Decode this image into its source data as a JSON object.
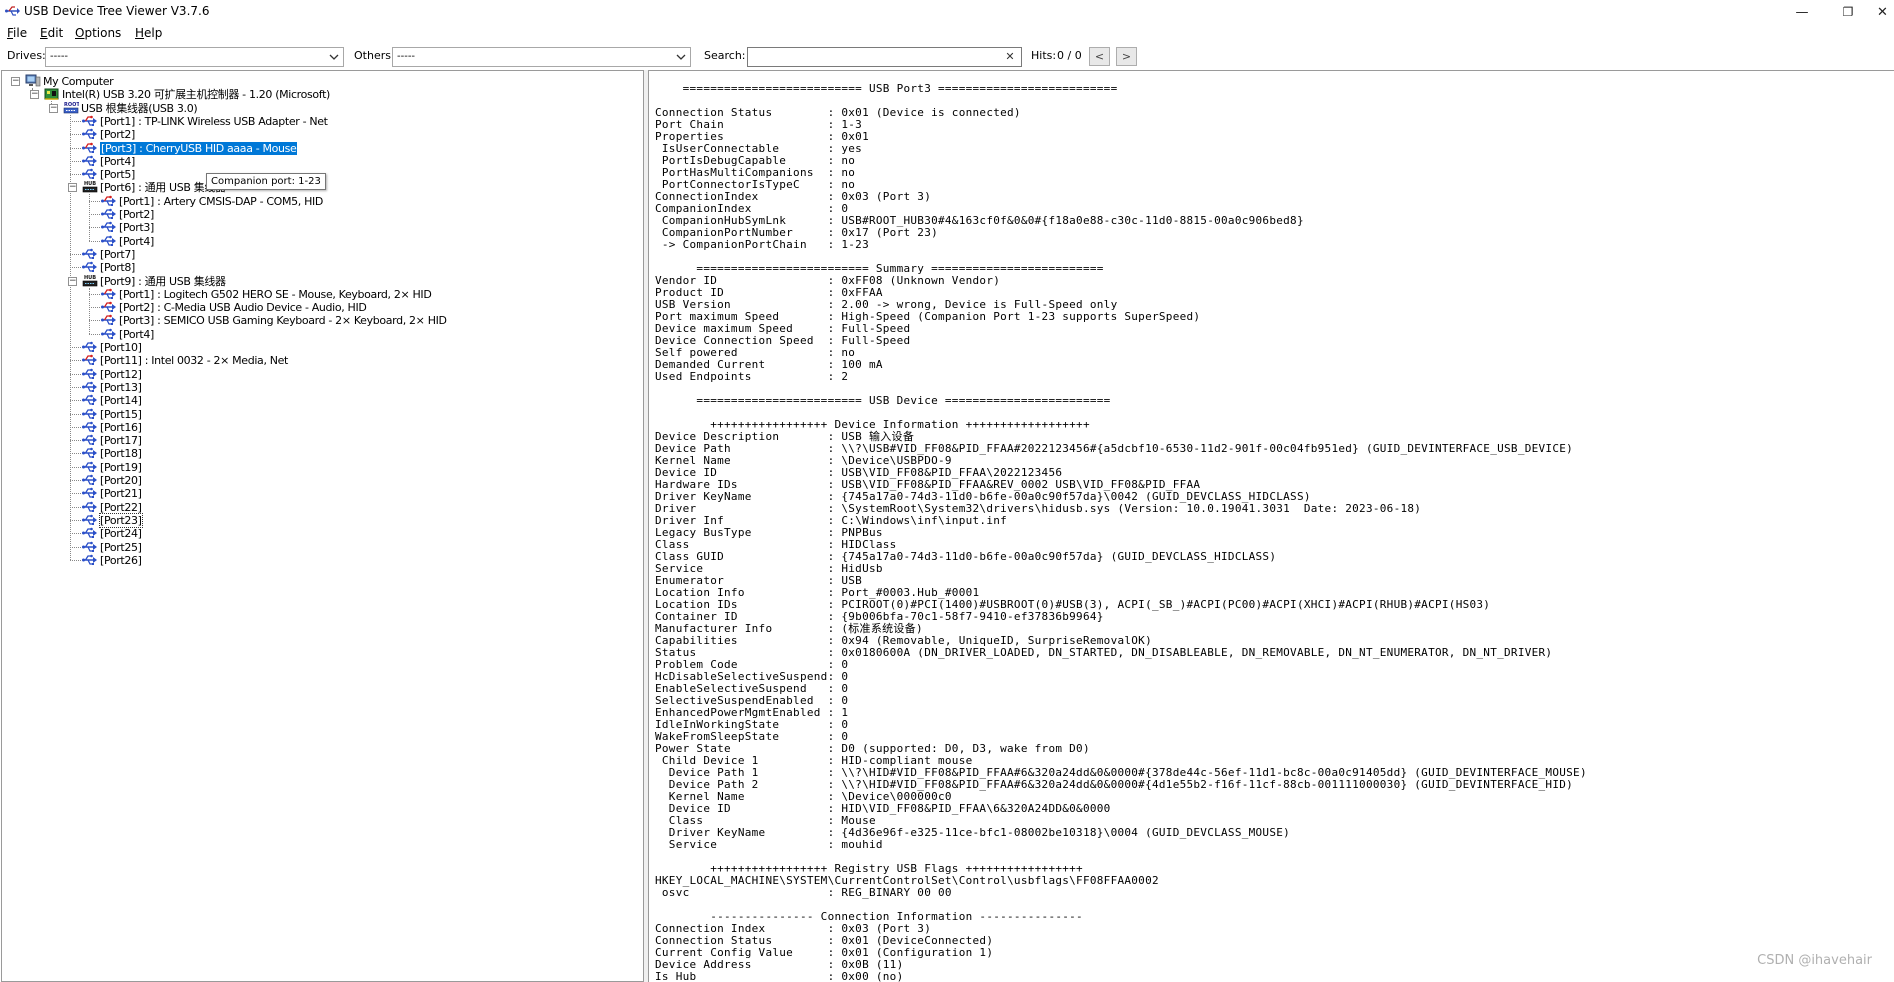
{
  "window": {
    "title": "USB Device Tree Viewer V3.7.6",
    "minimize": "—",
    "maximize": "❐",
    "close": "✕"
  },
  "menu": [
    {
      "label": "File",
      "mnemonic": "F",
      "rest": "ile"
    },
    {
      "label": "Edit",
      "mnemonic": "E",
      "rest": "dit"
    },
    {
      "label": "Options",
      "mnemonic": "O",
      "rest": "ptions"
    },
    {
      "label": "Help",
      "mnemonic": "H",
      "rest": "elp"
    }
  ],
  "toolbar": {
    "drives_label": "Drives:",
    "drives_value": "-----",
    "others_label": "Others:",
    "others_value": "-----",
    "search_label": "Search:",
    "search_value": "",
    "hits_label": "Hits:",
    "hits_value": "0 / 0",
    "prev": "<",
    "next": ">"
  },
  "tree": {
    "nodes": [
      {
        "label": "My Computer",
        "level": 0,
        "icon": "computer-icon",
        "expander": "−"
      },
      {
        "label": "Intel(R) USB 3.20 可扩展主机控制器 - 1.20 (Microsoft)",
        "level": 1,
        "icon": "host-controller-icon",
        "expander": "−"
      },
      {
        "label": "USB 根集线器(USB 3.0)",
        "level": 2,
        "icon": "root-hub-icon",
        "expander": "−"
      },
      {
        "label": "[Port1] : TP-LINK Wireless USB Adapter - Net",
        "level": 3,
        "icon": "usb-device-icon"
      },
      {
        "label": "[Port2]",
        "level": 3,
        "icon": "usb-port-icon"
      },
      {
        "label": "[Port3] : CherryUSB HID aaaa - Mouse",
        "level": 3,
        "icon": "usb-device-icon",
        "selected": true
      },
      {
        "label": "[Port4]",
        "level": 3,
        "icon": "usb-port-icon"
      },
      {
        "label": "[Port5]",
        "level": 3,
        "icon": "usb-port-icon"
      },
      {
        "label": "[Port6] : 通用 USB 集线器",
        "level": 3,
        "icon": "hub-icon",
        "expander": "−"
      },
      {
        "label": "[Port1] : Artery CMSIS-DAP - COM5, HID",
        "level": 4,
        "icon": "usb-device-icon"
      },
      {
        "label": "[Port2]",
        "level": 4,
        "icon": "usb-port-icon"
      },
      {
        "label": "[Port3]",
        "level": 4,
        "icon": "usb-port-icon"
      },
      {
        "label": "[Port4]",
        "level": 4,
        "icon": "usb-port-icon"
      },
      {
        "label": "[Port7]",
        "level": 3,
        "icon": "usb-port-icon"
      },
      {
        "label": "[Port8]",
        "level": 3,
        "icon": "usb-port-icon"
      },
      {
        "label": "[Port9] : 通用 USB 集线器",
        "level": 3,
        "icon": "hub-icon",
        "expander": "−"
      },
      {
        "label": "[Port1] : Logitech G502 HERO SE - Mouse, Keyboard, 2× HID",
        "level": 4,
        "icon": "usb-device-icon"
      },
      {
        "label": "[Port2] : C-Media USB Audio Device - Audio, HID",
        "level": 4,
        "icon": "usb-device-icon"
      },
      {
        "label": "[Port3] : SEMICO USB Gaming Keyboard - 2× Keyboard, 2× HID",
        "level": 4,
        "icon": "usb-device-icon"
      },
      {
        "label": "[Port4]",
        "level": 4,
        "icon": "usb-port-icon"
      },
      {
        "label": "[Port10]",
        "level": 3,
        "icon": "usb-port-icon"
      },
      {
        "label": "[Port11] : Intel 0032 - 2× Media, Net",
        "level": 3,
        "icon": "usb-device-icon"
      },
      {
        "label": "[Port12]",
        "level": 3,
        "icon": "usb-port-icon"
      },
      {
        "label": "[Port13]",
        "level": 3,
        "icon": "usb-port-icon"
      },
      {
        "label": "[Port14]",
        "level": 3,
        "icon": "usb-port-icon"
      },
      {
        "label": "[Port15]",
        "level": 3,
        "icon": "usb-port-icon"
      },
      {
        "label": "[Port16]",
        "level": 3,
        "icon": "usb-port-icon"
      },
      {
        "label": "[Port17]",
        "level": 3,
        "icon": "usb-port-icon"
      },
      {
        "label": "[Port18]",
        "level": 3,
        "icon": "usb-port-icon"
      },
      {
        "label": "[Port19]",
        "level": 3,
        "icon": "usb-port-icon"
      },
      {
        "label": "[Port20]",
        "level": 3,
        "icon": "usb-port-icon"
      },
      {
        "label": "[Port21]",
        "level": 3,
        "icon": "usb-port-icon"
      },
      {
        "label": "[Port22]",
        "level": 3,
        "icon": "usb-port-icon"
      },
      {
        "label": "[Port23]",
        "level": 3,
        "icon": "usb-port-icon",
        "boxed": true
      },
      {
        "label": "[Port24]",
        "level": 3,
        "icon": "usb-port-icon"
      },
      {
        "label": "[Port25]",
        "level": 3,
        "icon": "usb-port-icon"
      },
      {
        "label": "[Port26]",
        "level": 3,
        "icon": "usb-port-icon"
      }
    ],
    "tooltip": "Companion port: 1-23"
  },
  "details": {
    "lines": [
      "    ========================== USB Port3 ==========================",
      "",
      "Connection Status        : 0x01 (Device is connected)",
      "Port Chain               : 1-3",
      "Properties               : 0x01",
      " IsUserConnectable       : yes",
      " PortIsDebugCapable      : no",
      " PortHasMultiCompanions  : no",
      " PortConnectorIsTypeC    : no",
      "ConnectionIndex          : 0x03 (Port 3)",
      "CompanionIndex           : 0",
      " CompanionHubSymLnk      : USB#ROOT_HUB30#4&163cf0f&0&0#{f18a0e88-c30c-11d0-8815-00a0c906bed8}",
      " CompanionPortNumber     : 0x17 (Port 23)",
      " -> CompanionPortChain   : 1-23",
      "",
      "      ========================= Summary =========================",
      "Vendor ID                : 0xFF08 (Unknown Vendor)",
      "Product ID               : 0xFFAA",
      "USB Version              : 2.00 -> wrong, Device is Full-Speed only",
      "Port maximum Speed       : High-Speed (Companion Port 1-23 supports SuperSpeed)",
      "Device maximum Speed     : Full-Speed",
      "Device Connection Speed  : Full-Speed",
      "Self powered             : no",
      "Demanded Current         : 100 mA",
      "Used Endpoints           : 2",
      "",
      "      ======================== USB Device ========================",
      "",
      "        +++++++++++++++++ Device Information ++++++++++++++++++",
      "Device Description       : USB 输入设备",
      "Device Path              : \\\\?\\USB#VID_FF08&PID_FFAA#2022123456#{a5dcbf10-6530-11d2-901f-00c04fb951ed} (GUID_DEVINTERFACE_USB_DEVICE)",
      "Kernel Name              : \\Device\\USBPDO-9",
      "Device ID                : USB\\VID_FF08&PID_FFAA\\2022123456",
      "Hardware IDs             : USB\\VID_FF08&PID_FFAA&REV_0002 USB\\VID_FF08&PID_FFAA",
      "Driver KeyName           : {745a17a0-74d3-11d0-b6fe-00a0c90f57da}\\0042 (GUID_DEVCLASS_HIDCLASS)",
      "Driver                   : \\SystemRoot\\System32\\drivers\\hidusb.sys (Version: 10.0.19041.3031  Date: 2023-06-18)",
      "Driver Inf               : C:\\Windows\\inf\\input.inf",
      "Legacy BusType           : PNPBus",
      "Class                    : HIDClass",
      "Class GUID               : {745a17a0-74d3-11d0-b6fe-00a0c90f57da} (GUID_DEVCLASS_HIDCLASS)",
      "Service                  : HidUsb",
      "Enumerator               : USB",
      "Location Info            : Port_#0003.Hub_#0001",
      "Location IDs             : PCIROOT(0)#PCI(1400)#USBROOT(0)#USB(3), ACPI(_SB_)#ACPI(PC00)#ACPI(XHCI)#ACPI(RHUB)#ACPI(HS03)",
      "Container ID             : {9b006bfa-70c1-58f7-9410-ef37836b9964}",
      "Manufacturer Info        : (标准系统设备)",
      "Capabilities             : 0x94 (Removable, UniqueID, SurpriseRemovalOK)",
      "Status                   : 0x0180600A (DN_DRIVER_LOADED, DN_STARTED, DN_DISABLEABLE, DN_REMOVABLE, DN_NT_ENUMERATOR, DN_NT_DRIVER)",
      "Problem Code             : 0",
      "HcDisableSelectiveSuspend: 0",
      "EnableSelectiveSuspend   : 0",
      "SelectiveSuspendEnabled  : 0",
      "EnhancedPowerMgmtEnabled : 1",
      "IdleInWorkingState       : 0",
      "WakeFromSleepState       : 0",
      "Power State              : D0 (supported: D0, D3, wake from D0)",
      " Child Device 1          : HID-compliant mouse",
      "  Device Path 1          : \\\\?\\HID#VID_FF08&PID_FFAA#6&320a24dd&0&0000#{378de44c-56ef-11d1-bc8c-00a0c91405dd} (GUID_DEVINTERFACE_MOUSE)",
      "  Device Path 2          : \\\\?\\HID#VID_FF08&PID_FFAA#6&320a24dd&0&0000#{4d1e55b2-f16f-11cf-88cb-001111000030} (GUID_DEVINTERFACE_HID)",
      "  Kernel Name            : \\Device\\000000c0",
      "  Device ID              : HID\\VID_FF08&PID_FFAA\\6&320A24DD&0&0000",
      "  Class                  : Mouse",
      "  Driver KeyName         : {4d36e96f-e325-11ce-bfc1-08002be10318}\\0004 (GUID_DEVCLASS_MOUSE)",
      "  Service                : mouhid",
      "",
      "        +++++++++++++++++ Registry USB Flags +++++++++++++++++",
      "HKEY_LOCAL_MACHINE\\SYSTEM\\CurrentControlSet\\Control\\usbflags\\FF08FFAA0002",
      " osvc                    : REG_BINARY 00 00",
      "",
      "        --------------- Connection Information ---------------",
      "Connection Index         : 0x03 (Port 3)",
      "Connection Status        : 0x01 (DeviceConnected)",
      "Current Config Value     : 0x01 (Configuration 1)",
      "Device Address           : 0x0B (11)",
      "Is Hub                   : 0x00 (no)"
    ]
  },
  "watermark": "CSDN @ihavehair"
}
